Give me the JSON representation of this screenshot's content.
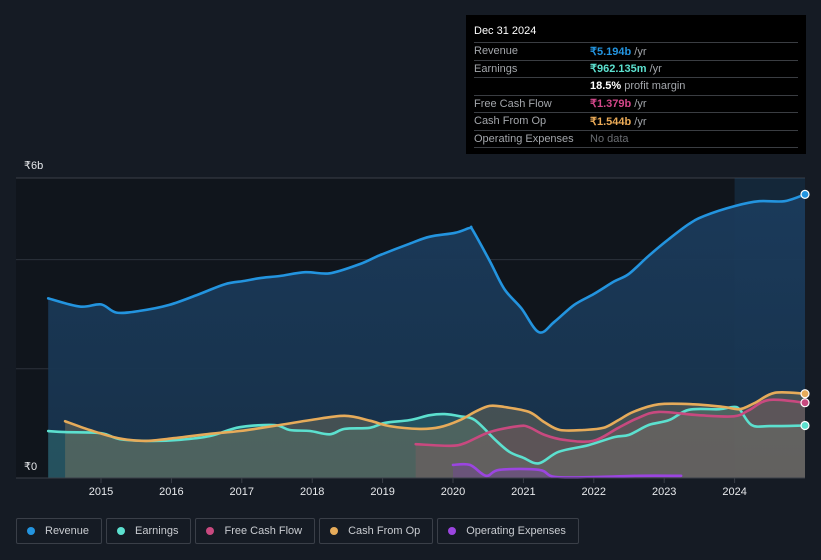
{
  "tooltip": {
    "date": "Dec 31 2024",
    "rows": [
      {
        "label": "Revenue",
        "value": "₹5.194b",
        "suffix": " /yr",
        "color": "#2394df"
      },
      {
        "label": "Earnings",
        "value": "₹962.135m",
        "suffix": " /yr",
        "color": "#5ce0cf"
      },
      {
        "label": "",
        "value": "18.5%",
        "suffix": " profit margin",
        "color": "#ffffff"
      },
      {
        "label": "Free Cash Flow",
        "value": "₹1.379b",
        "suffix": " /yr",
        "color": "#d3478a"
      },
      {
        "label": "Cash From Op",
        "value": "₹1.544b",
        "suffix": " /yr",
        "color": "#eaaa57"
      },
      {
        "label": "Operating Expenses",
        "value": "No data",
        "suffix": "",
        "color": "#6b6e73"
      }
    ]
  },
  "legend": [
    {
      "label": "Revenue",
      "color": "#2394df"
    },
    {
      "label": "Earnings",
      "color": "#5ce0cf"
    },
    {
      "label": "Free Cash Flow",
      "color": "#c8497f"
    },
    {
      "label": "Cash From Op",
      "color": "#e6ab5a"
    },
    {
      "label": "Operating Expenses",
      "color": "#9b45e0"
    }
  ],
  "chart_data": {
    "type": "area",
    "title": "",
    "xlabel": "",
    "ylabel": "",
    "currency": "₹",
    "y_tick_labels": [
      "₹6b",
      "₹0"
    ],
    "ylim": [
      0,
      5.5
    ],
    "gridlines_b": [
      2,
      4
    ],
    "xlim": [
      2014.25,
      2025.0
    ],
    "x_ticks": [
      2015,
      2016,
      2017,
      2018,
      2019,
      2020,
      2021,
      2022,
      2023,
      2024
    ],
    "highlight_start": 2024.0,
    "grid": true,
    "legend_position": "bottom",
    "unit": "billions INR",
    "series": [
      {
        "name": "Revenue",
        "color": "#2394df",
        "points": [
          [
            2014.25,
            3.29
          ],
          [
            2014.7,
            3.14
          ],
          [
            2015.0,
            3.18
          ],
          [
            2015.22,
            3.03
          ],
          [
            2015.55,
            3.06
          ],
          [
            2015.97,
            3.17
          ],
          [
            2016.4,
            3.37
          ],
          [
            2016.76,
            3.55
          ],
          [
            2017.04,
            3.61
          ],
          [
            2017.25,
            3.66
          ],
          [
            2017.54,
            3.7
          ],
          [
            2017.9,
            3.77
          ],
          [
            2018.25,
            3.75
          ],
          [
            2018.68,
            3.92
          ],
          [
            2018.96,
            4.08
          ],
          [
            2019.38,
            4.29
          ],
          [
            2019.67,
            4.42
          ],
          [
            2020.03,
            4.49
          ],
          [
            2020.24,
            4.58
          ],
          [
            2020.28,
            4.54
          ],
          [
            2020.52,
            3.98
          ],
          [
            2020.73,
            3.46
          ],
          [
            2020.97,
            3.11
          ],
          [
            2021.22,
            2.67
          ],
          [
            2021.44,
            2.86
          ],
          [
            2021.72,
            3.17
          ],
          [
            2022.0,
            3.37
          ],
          [
            2022.29,
            3.6
          ],
          [
            2022.5,
            3.74
          ],
          [
            2022.78,
            4.07
          ],
          [
            2023.07,
            4.38
          ],
          [
            2023.35,
            4.65
          ],
          [
            2023.57,
            4.8
          ],
          [
            2024.0,
            4.98
          ],
          [
            2024.35,
            5.07
          ],
          [
            2024.71,
            5.07
          ],
          [
            2025.0,
            5.194
          ]
        ]
      },
      {
        "name": "Earnings",
        "color": "#5ce0cf",
        "points": [
          [
            2014.25,
            0.86
          ],
          [
            2014.49,
            0.84
          ],
          [
            2015.0,
            0.82
          ],
          [
            2015.27,
            0.71
          ],
          [
            2015.7,
            0.68
          ],
          [
            2016.12,
            0.7
          ],
          [
            2016.55,
            0.77
          ],
          [
            2016.97,
            0.93
          ],
          [
            2017.46,
            0.97
          ],
          [
            2017.68,
            0.88
          ],
          [
            2017.97,
            0.86
          ],
          [
            2018.25,
            0.8
          ],
          [
            2018.46,
            0.9
          ],
          [
            2018.82,
            0.92
          ],
          [
            2019.03,
            1.01
          ],
          [
            2019.38,
            1.06
          ],
          [
            2019.67,
            1.15
          ],
          [
            2019.88,
            1.17
          ],
          [
            2020.1,
            1.13
          ],
          [
            2020.31,
            1.06
          ],
          [
            2020.6,
            0.7
          ],
          [
            2020.8,
            0.48
          ],
          [
            2021.0,
            0.37
          ],
          [
            2021.22,
            0.27
          ],
          [
            2021.5,
            0.48
          ],
          [
            2021.92,
            0.6
          ],
          [
            2022.29,
            0.75
          ],
          [
            2022.5,
            0.79
          ],
          [
            2022.78,
            0.97
          ],
          [
            2023.07,
            1.06
          ],
          [
            2023.35,
            1.25
          ],
          [
            2023.78,
            1.26
          ],
          [
            2023.97,
            1.3
          ],
          [
            2024.07,
            1.26
          ],
          [
            2024.24,
            0.97
          ],
          [
            2024.5,
            0.95
          ],
          [
            2025.0,
            0.962
          ]
        ]
      },
      {
        "name": "Free Cash Flow",
        "color": "#c8497f",
        "points": [
          [
            2019.47,
            0.62
          ],
          [
            2019.96,
            0.59
          ],
          [
            2020.17,
            0.64
          ],
          [
            2020.52,
            0.84
          ],
          [
            2020.94,
            0.95
          ],
          [
            2021.08,
            0.93
          ],
          [
            2021.3,
            0.79
          ],
          [
            2021.57,
            0.7
          ],
          [
            2021.99,
            0.68
          ],
          [
            2022.35,
            0.92
          ],
          [
            2022.63,
            1.1
          ],
          [
            2022.92,
            1.21
          ],
          [
            2023.49,
            1.15
          ],
          [
            2023.99,
            1.13
          ],
          [
            2024.2,
            1.24
          ],
          [
            2024.49,
            1.43
          ],
          [
            2025.0,
            1.379
          ]
        ]
      },
      {
        "name": "Cash From Op",
        "color": "#e6ab5a",
        "points": [
          [
            2014.49,
            1.04
          ],
          [
            2014.84,
            0.88
          ],
          [
            2015.24,
            0.73
          ],
          [
            2015.62,
            0.68
          ],
          [
            2016.05,
            0.73
          ],
          [
            2016.55,
            0.81
          ],
          [
            2016.97,
            0.86
          ],
          [
            2017.54,
            0.97
          ],
          [
            2017.97,
            1.06
          ],
          [
            2018.46,
            1.14
          ],
          [
            2018.82,
            1.05
          ],
          [
            2019.1,
            0.95
          ],
          [
            2019.53,
            0.9
          ],
          [
            2019.81,
            0.93
          ],
          [
            2020.1,
            1.06
          ],
          [
            2020.31,
            1.21
          ],
          [
            2020.52,
            1.32
          ],
          [
            2020.73,
            1.3
          ],
          [
            2021.08,
            1.21
          ],
          [
            2021.3,
            1.02
          ],
          [
            2021.52,
            0.88
          ],
          [
            2021.86,
            0.88
          ],
          [
            2022.14,
            0.92
          ],
          [
            2022.35,
            1.06
          ],
          [
            2022.56,
            1.21
          ],
          [
            2022.92,
            1.35
          ],
          [
            2023.42,
            1.35
          ],
          [
            2023.85,
            1.3
          ],
          [
            2024.07,
            1.26
          ],
          [
            2024.28,
            1.37
          ],
          [
            2024.57,
            1.56
          ],
          [
            2025.0,
            1.544
          ]
        ]
      },
      {
        "name": "Operating Expenses",
        "color": "#9b45e0",
        "points": [
          [
            2020.0,
            0.24
          ],
          [
            2020.24,
            0.24
          ],
          [
            2020.47,
            0.04
          ],
          [
            2020.66,
            0.15
          ],
          [
            2021.22,
            0.15
          ],
          [
            2021.45,
            0.02
          ],
          [
            2022.07,
            0.02
          ],
          [
            2022.64,
            0.04
          ],
          [
            2023.24,
            0.04
          ]
        ]
      }
    ]
  }
}
